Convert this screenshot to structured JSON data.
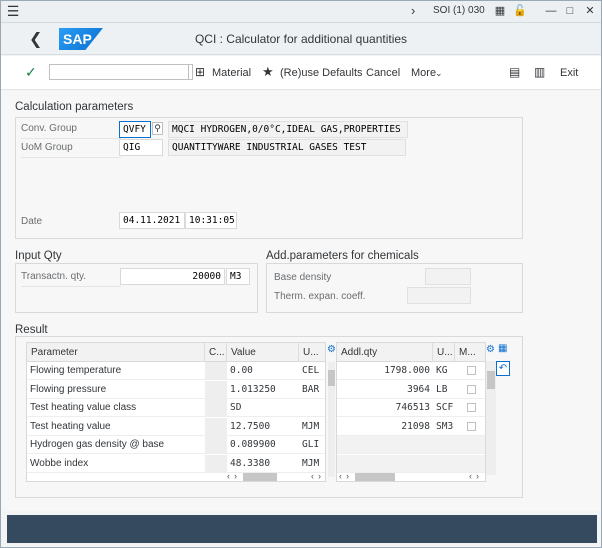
{
  "system": {
    "session": "SOI (1) 030"
  },
  "shell": {
    "logo": "SAP",
    "title": "QCI : Calculator for additional quantities"
  },
  "toolbar": {
    "material": "Material",
    "reuse": "(Re)use Defaults",
    "cancel": "Cancel",
    "more": "More",
    "exit": "Exit"
  },
  "calc": {
    "title": "Calculation parameters",
    "conv_group_label": "Conv. Group",
    "conv_group_value": "QVFY",
    "conv_group_desc": "MQCI HYDROGEN,0/0°C,IDEAL GAS,PROPERTIES",
    "uom_group_label": "UoM Group",
    "uom_group_value": "QIG",
    "uom_group_desc": "QUANTITYWARE INDUSTRIAL GASES TEST",
    "date_label": "Date",
    "date_value": "04.11.2021",
    "time_value": "10:31:05"
  },
  "input": {
    "title": "Input Qty",
    "qty_label": "Transactn. qty.",
    "qty_value": "20000",
    "qty_unit": "M3"
  },
  "addparams": {
    "title": "Add.parameters for chemicals",
    "base_density_label": "Base density",
    "therm_label": "Therm. expan. coeff."
  },
  "result": {
    "title": "Result",
    "left_headers": [
      "Parameter",
      "C...",
      "Value",
      "U..."
    ],
    "left_rows": [
      {
        "param": "Flowing temperature",
        "value": "0.00",
        "unit": "CEL"
      },
      {
        "param": "Flowing pressure",
        "value": "1.013250",
        "unit": "BAR"
      },
      {
        "param": "Test heating value class",
        "value": "SD",
        "unit": ""
      },
      {
        "param": "Test heating value",
        "value": "12.7500",
        "unit": "MJM"
      },
      {
        "param": "Hydrogen gas density @ base",
        "value": "0.089900",
        "unit": "GLI"
      },
      {
        "param": "Wobbe index",
        "value": "48.3380",
        "unit": "MJM"
      }
    ],
    "right_headers": [
      "Addl.qty",
      "U...",
      "M..."
    ],
    "right_rows": [
      {
        "qty": "1798.000",
        "unit": "KG"
      },
      {
        "qty": "3964",
        "unit": "LB"
      },
      {
        "qty": "746513",
        "unit": "SCF"
      },
      {
        "qty": "21098",
        "unit": "SM3"
      }
    ]
  }
}
